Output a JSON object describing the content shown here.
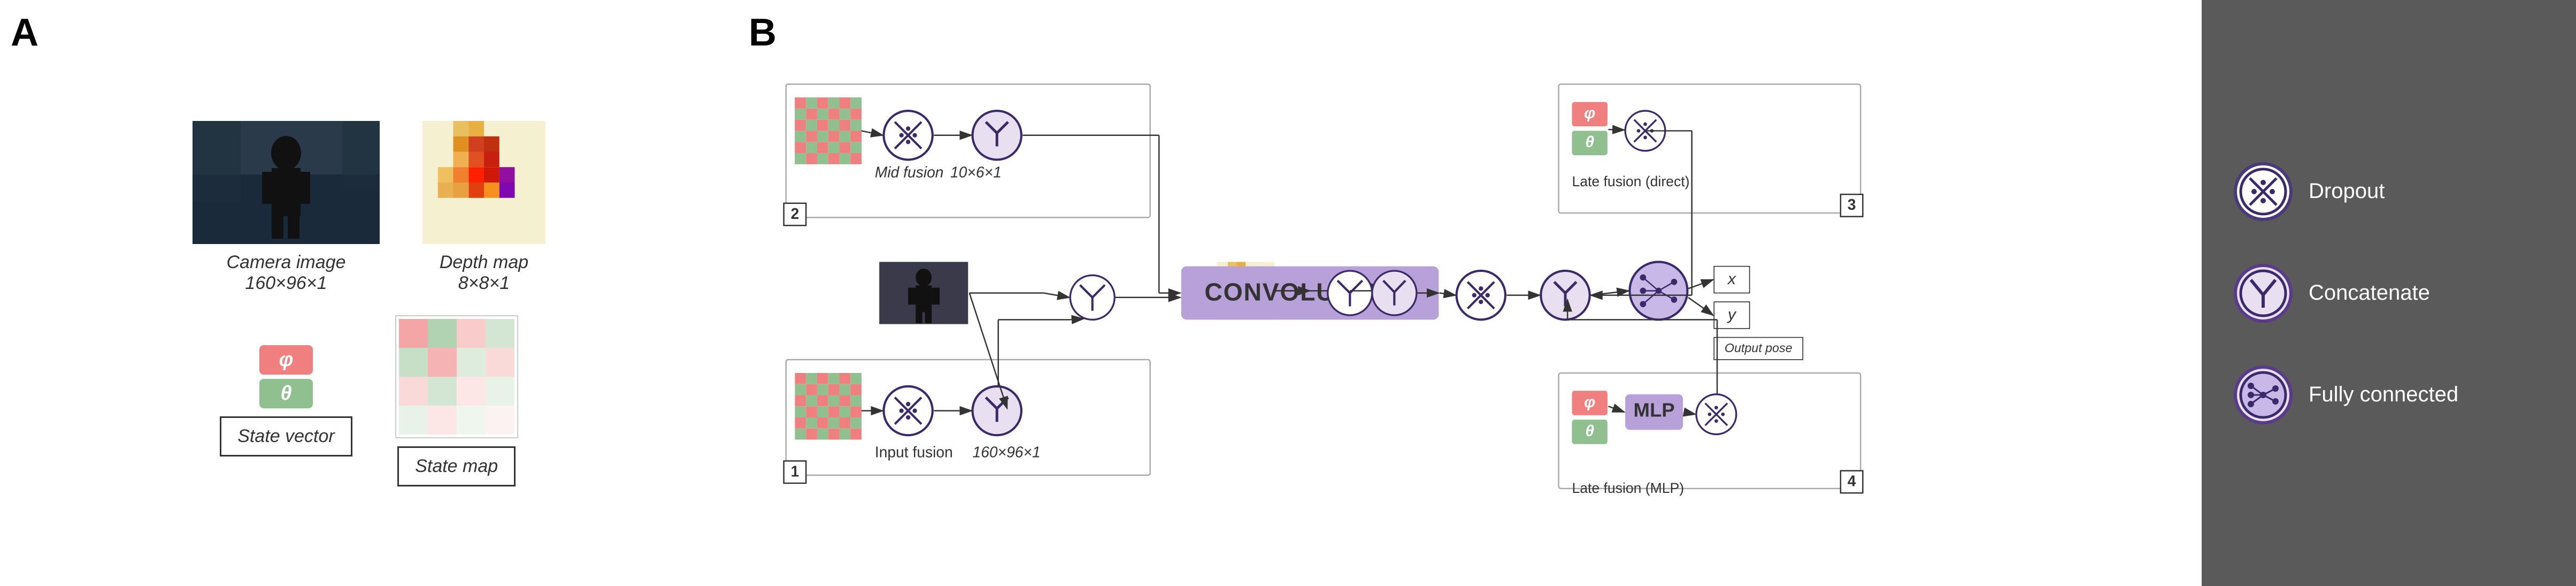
{
  "panelA": {
    "label": "A",
    "cameraImage": {
      "caption": "Camera image",
      "dimensions": "160×96×1"
    },
    "depthMap": {
      "caption": "Depth map",
      "dimensions": "8×8×1"
    },
    "stateVector": {
      "phi": "φ",
      "theta": "θ",
      "label": "State vector"
    },
    "stateMap": {
      "label": "State map"
    }
  },
  "panelB": {
    "label": "B",
    "boxes": {
      "midFusion": {
        "number": "2",
        "label": "Mid fusion",
        "dimensions": "10×6×1"
      },
      "inputFusion": {
        "number": "1",
        "label": "Input fusion",
        "dimensions": "160×96×1"
      },
      "lateFusionDirect": {
        "number": "3",
        "label": "Late fusion (direct)"
      },
      "lateFusionMLP": {
        "number": "4",
        "label": "Late fusion (MLP)"
      }
    },
    "convolutions": "CONVOLUTIONS",
    "mlp": "MLP",
    "outputs": {
      "x": "x",
      "y": "y",
      "label": "Output pose"
    }
  },
  "legend": {
    "dropout": {
      "label": "Dropout"
    },
    "concatenate": {
      "label": "Concatenate"
    },
    "fullyConnected": {
      "label": "Fully connected"
    }
  }
}
